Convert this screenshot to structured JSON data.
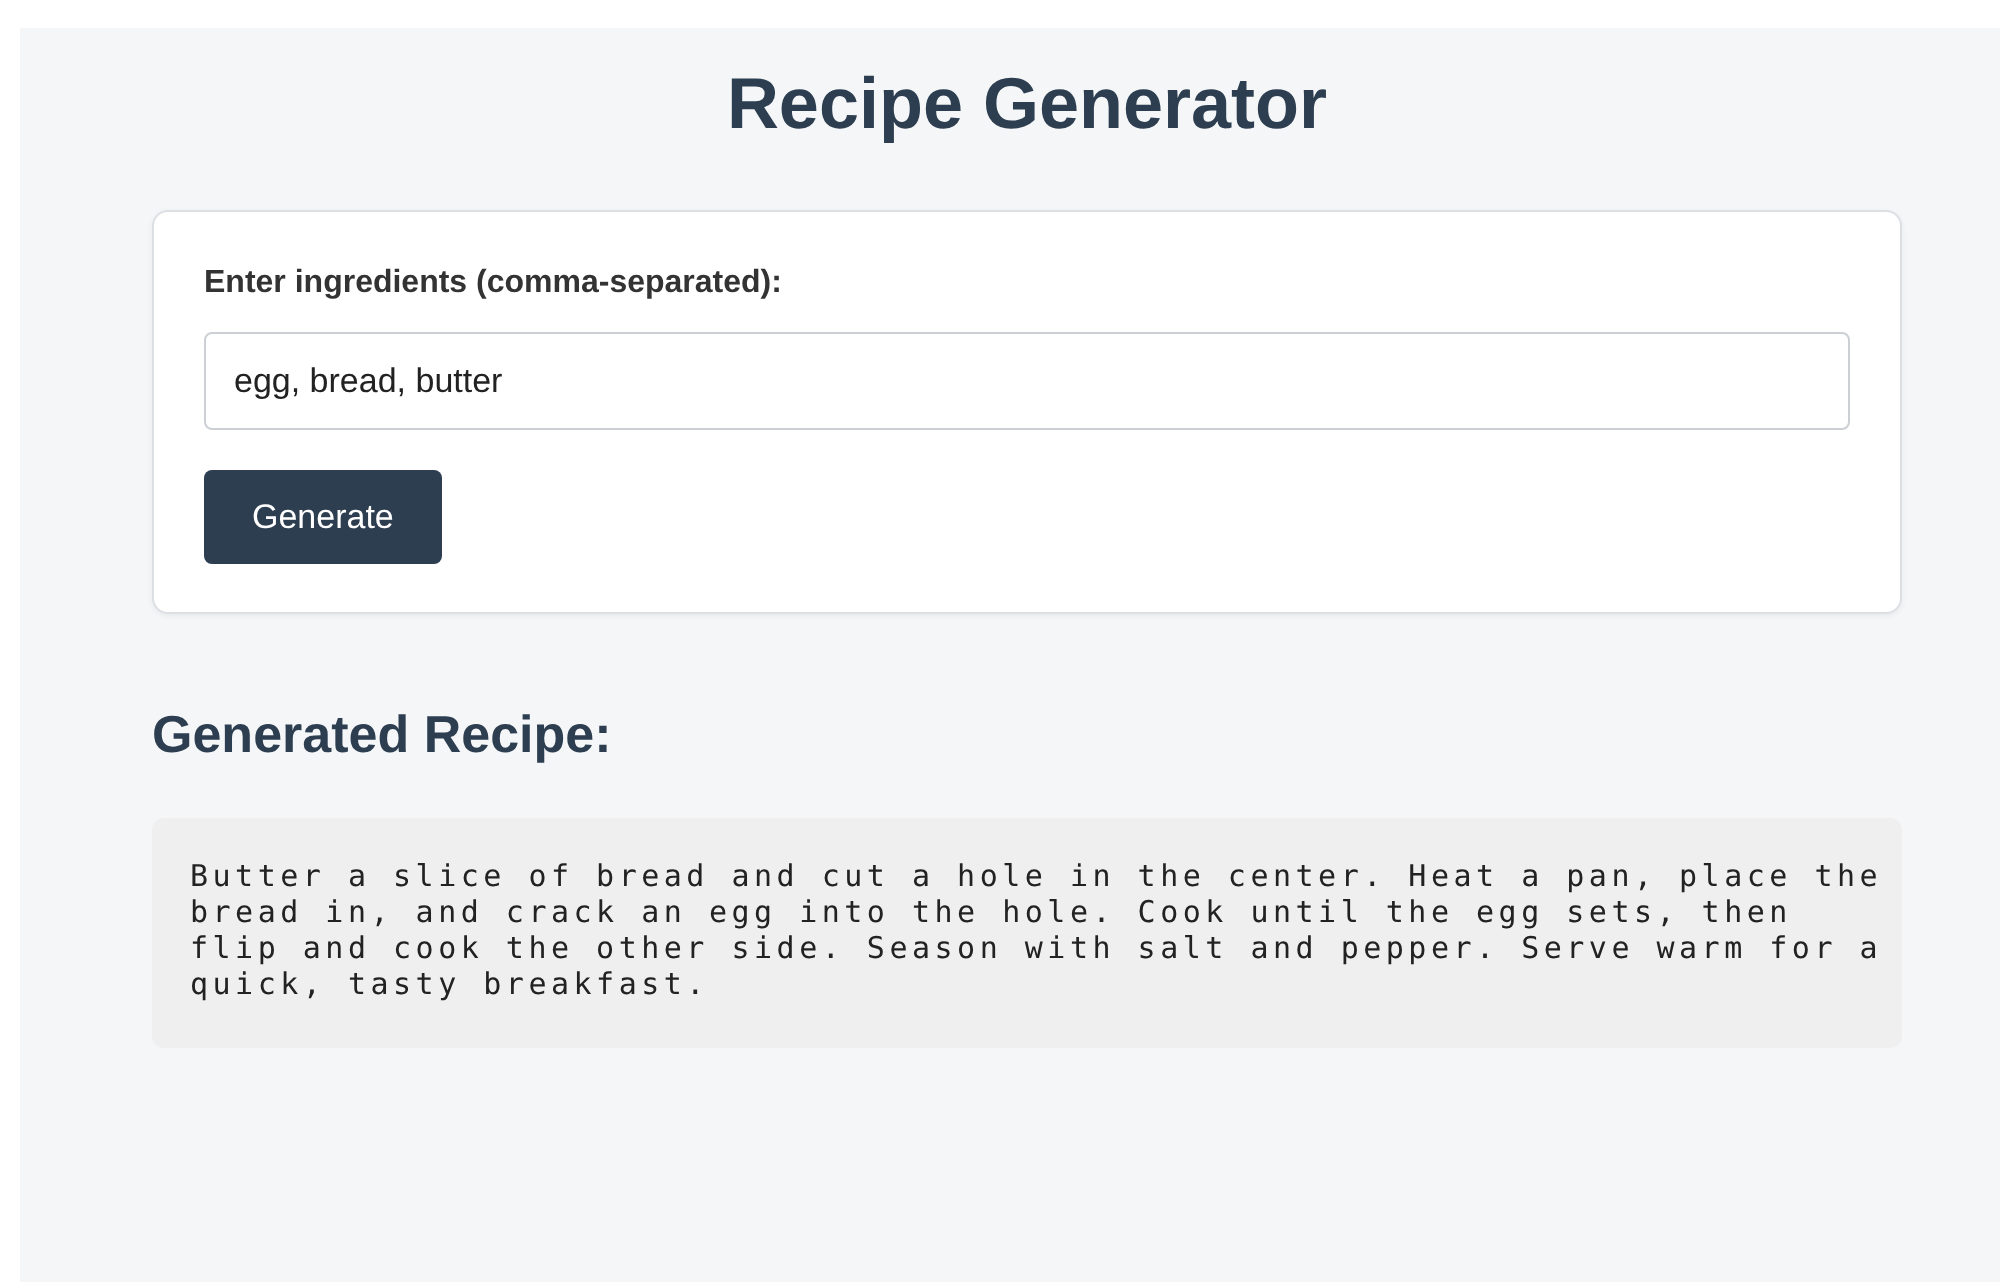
{
  "title": "Recipe Generator",
  "form": {
    "label": "Enter ingredients (comma-separated):",
    "value": "egg, bread, butter",
    "button": "Generate"
  },
  "result": {
    "heading": "Generated Recipe:",
    "text": "Butter a slice of bread and cut a hole in the center. Heat a pan, place the bread in, and crack an egg into the hole. Cook until the egg sets, then flip and cook the other side. Season with salt and pepper. Serve warm for a quick, tasty breakfast."
  }
}
